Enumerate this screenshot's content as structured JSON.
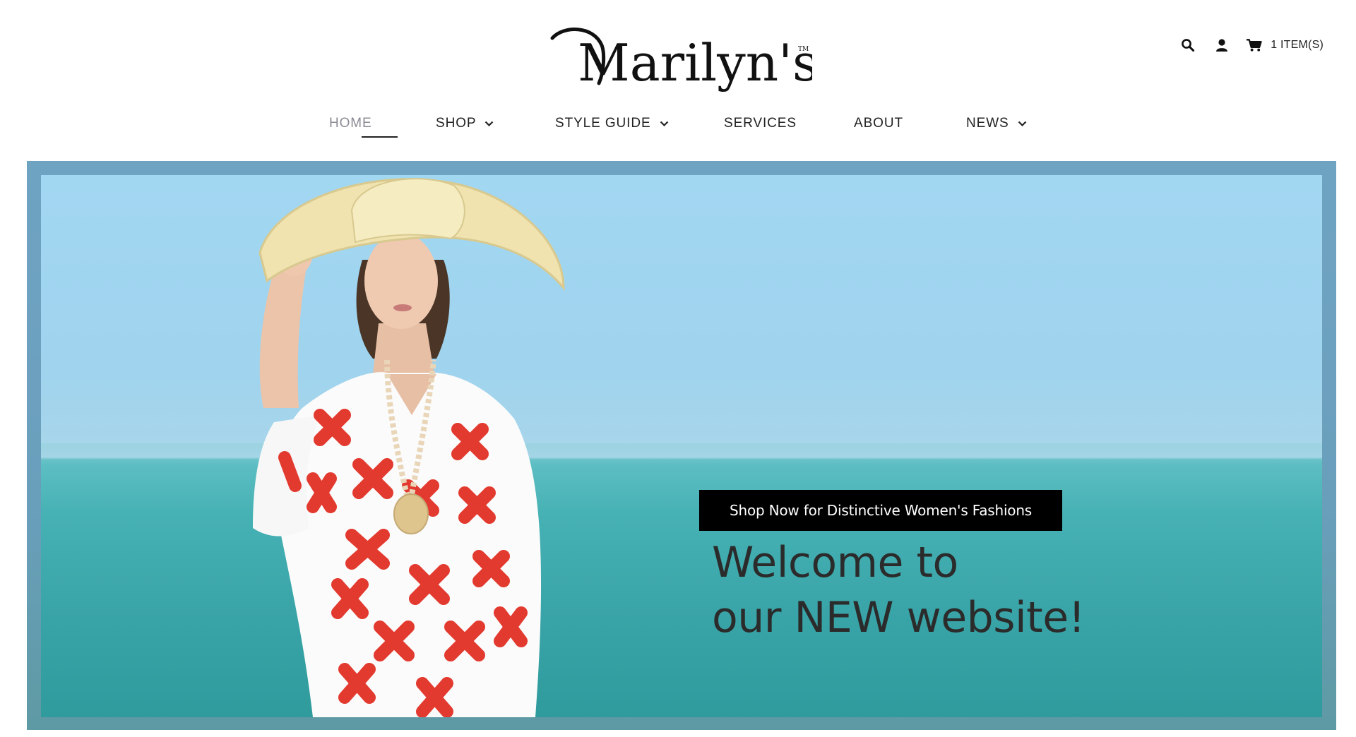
{
  "brand": {
    "name": "Marilyn's",
    "trademark": "TM"
  },
  "utility": {
    "search_icon": "search-icon",
    "account_icon": "user-icon",
    "cart_icon": "cart-icon",
    "cart_label": "1 ITEM(S)"
  },
  "nav": {
    "items": [
      {
        "label": "HOME",
        "active": true,
        "dropdown": false
      },
      {
        "label": "SHOP",
        "active": false,
        "dropdown": true
      },
      {
        "label": "STYLE GUIDE",
        "active": false,
        "dropdown": true
      },
      {
        "label": "SERVICES",
        "active": false,
        "dropdown": false
      },
      {
        "label": "ABOUT",
        "active": false,
        "dropdown": false
      },
      {
        "label": "NEWS",
        "active": false,
        "dropdown": true
      }
    ]
  },
  "hero": {
    "title_line1": "Welcome to",
    "title_line2": "our NEW website!",
    "cta_label": "Shop Now for Distinctive Women's Fashions"
  },
  "colors": {
    "nav_text": "#222222",
    "nav_active": "#8b8b95",
    "cta_bg": "#000000",
    "cta_text": "#ffffff",
    "sky": "#a2d7f2",
    "sea": "#3aa5a8",
    "frame": "#6a9fbc"
  }
}
